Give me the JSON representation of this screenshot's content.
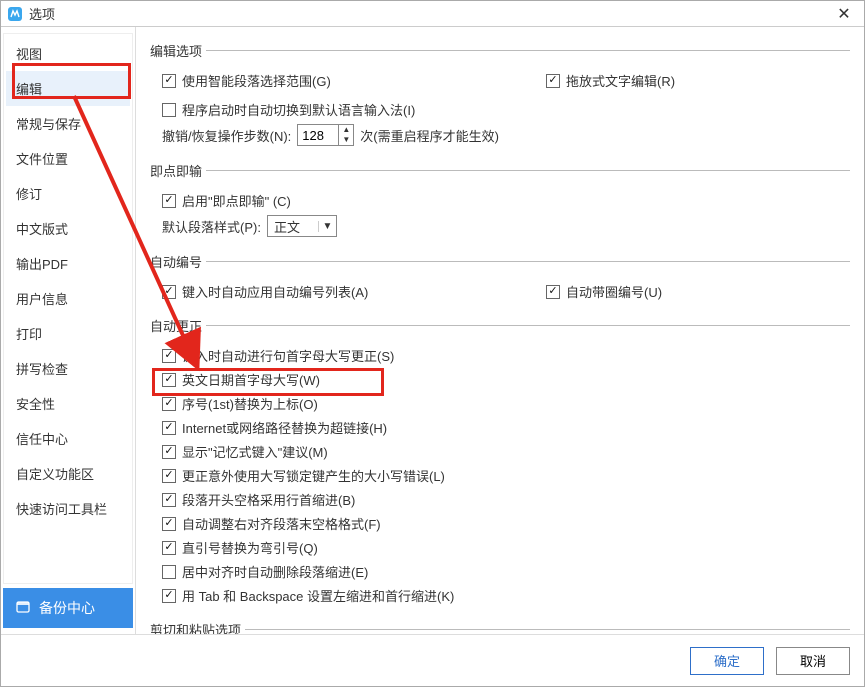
{
  "titlebar": {
    "title": "选项"
  },
  "sidebar": {
    "items": [
      {
        "label": "视图"
      },
      {
        "label": "编辑"
      },
      {
        "label": "常规与保存"
      },
      {
        "label": "文件位置"
      },
      {
        "label": "修订"
      },
      {
        "label": "中文版式"
      },
      {
        "label": "输出PDF"
      },
      {
        "label": "用户信息"
      },
      {
        "label": "打印"
      },
      {
        "label": "拼写检查"
      },
      {
        "label": "安全性"
      },
      {
        "label": "信任中心"
      },
      {
        "label": "自定义功能区"
      },
      {
        "label": "快速访问工具栏"
      }
    ],
    "selected_index": 1,
    "backup_label": "备份中心"
  },
  "sections": {
    "edit_options": {
      "legend": "编辑选项",
      "smart_paragraph": {
        "label": "使用智能段落选择范围(G)",
        "checked": true
      },
      "drag_edit": {
        "label": "拖放式文字编辑(R)",
        "checked": true
      },
      "ime_default": {
        "label": "程序启动时自动切换到默认语言输入法(I)",
        "checked": false
      },
      "undo": {
        "label_before": "撤销/恢复操作步数(N):",
        "value": "128",
        "label_after": "次(需重启程序才能生效)"
      }
    },
    "click_type": {
      "legend": "即点即输",
      "enable": {
        "label": "启用\"即点即输\" (C)",
        "checked": true
      },
      "default_style_label": "默认段落样式(P):",
      "default_style_value": "正文"
    },
    "auto_number": {
      "legend": "自动编号",
      "apply_list": {
        "label": "键入时自动应用自动编号列表(A)",
        "checked": true
      },
      "auto_circle": {
        "label": "自动带圈编号(U)",
        "checked": true
      }
    },
    "auto_correct": {
      "legend": "自动更正",
      "items": [
        {
          "label": "键入时自动进行句首字母大写更正(S)",
          "checked": true
        },
        {
          "label": "英文日期首字母大写(W)",
          "checked": true
        },
        {
          "label": "序号(1st)替换为上标(O)",
          "checked": true
        },
        {
          "label": "Internet或网络路径替换为超链接(H)",
          "checked": true
        },
        {
          "label": "显示\"记忆式键入\"建议(M)",
          "checked": true
        },
        {
          "label": "更正意外使用大写锁定键产生的大小写错误(L)",
          "checked": true
        },
        {
          "label": "段落开头空格采用行首缩进(B)",
          "checked": true
        },
        {
          "label": "自动调整右对齐段落末空格格式(F)",
          "checked": true
        },
        {
          "label": "直引号替换为弯引号(Q)",
          "checked": true
        },
        {
          "label": "居中对齐时自动删除段落缩进(E)",
          "checked": false
        },
        {
          "label": "用 Tab 和 Backspace 设置左缩进和首行缩进(K)",
          "checked": true
        }
      ]
    },
    "cut_paste": {
      "legend": "剪切和粘贴选项"
    }
  },
  "footer": {
    "ok": "确定",
    "cancel": "取消"
  }
}
